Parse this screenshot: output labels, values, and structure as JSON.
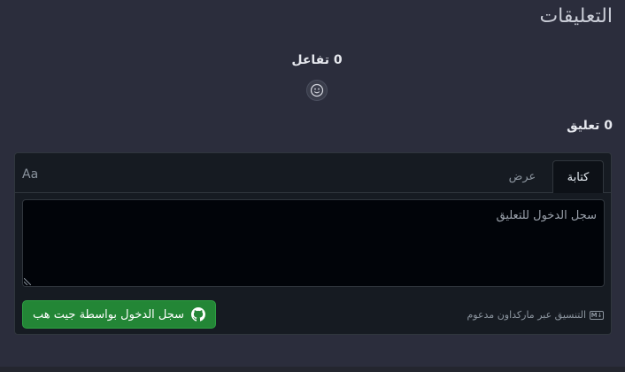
{
  "section": {
    "title": "التعليقات"
  },
  "reactions": {
    "count_label": "0 تفاعل",
    "emoji_icon": "smiley-icon"
  },
  "comments": {
    "count_label": "0 تعليق"
  },
  "editor": {
    "tabs": [
      {
        "label": "كتابة",
        "active": true
      },
      {
        "label": "عرض",
        "active": false
      }
    ],
    "font_toggle": "Aa",
    "placeholder": "سجل الدخول للتعليق",
    "markdown_note": "التنسيق عبر ماركداون مدعوم",
    "markdown_icon": "markdown-icon",
    "signin_label": "سجل الدخول بواسطة جيت هب",
    "signin_icon": "github-icon"
  },
  "colors": {
    "primary_button": "#238636",
    "background": "#2b2d3c",
    "panel": "#161b22"
  }
}
